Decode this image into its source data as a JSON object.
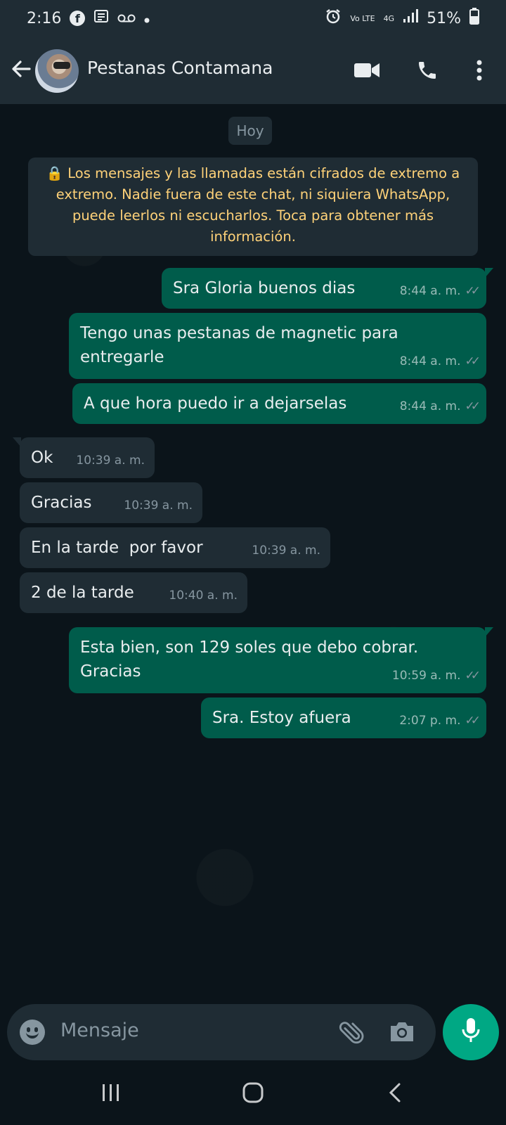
{
  "status_bar": {
    "time": "2:16",
    "battery": "51%",
    "network": "4G",
    "volte": "Vo LTE"
  },
  "header": {
    "contact_name": "Pestanas Contamana",
    "icons": [
      "back-arrow-icon",
      "avatar",
      "video-call-icon",
      "voice-call-icon",
      "more-options-icon"
    ]
  },
  "chat": {
    "day_label": "Hoy",
    "encryption_notice": "🔒 Los mensajes y las llamadas están cifrados de extremo a extremo. Nadie fuera de este chat, ni siquiera WhatsApp, puede leerlos ni escucharlos. Toca para obtener más información.",
    "messages": [
      {
        "direction": "out",
        "text": "Sra Gloria buenos dias",
        "time": "8:44 a. m."
      },
      {
        "direction": "out",
        "text": "Tengo unas pestanas de magnetic para entregarle",
        "time": "8:44 a. m."
      },
      {
        "direction": "out",
        "text": "A que hora puedo ir a dejarselas",
        "time": "8:44 a. m."
      },
      {
        "direction": "in",
        "text": "Ok",
        "time": "10:39 a. m."
      },
      {
        "direction": "in",
        "text": "Gracias",
        "time": "10:39 a. m."
      },
      {
        "direction": "in",
        "text": "En la tarde  por favor",
        "time": "10:39 a. m."
      },
      {
        "direction": "in",
        "text": "2 de la tarde",
        "time": "10:40 a. m."
      },
      {
        "direction": "out",
        "text": "Esta bien, son 129 soles que debo cobrar. Gracias",
        "time": "10:59 a. m."
      },
      {
        "direction": "out",
        "text": "Sra. Estoy afuera",
        "time": "2:07 p. m."
      }
    ]
  },
  "composer": {
    "placeholder": "Mensaje"
  },
  "colors": {
    "outgoing_bubble": "#005c4b",
    "incoming_bubble": "#1f2c34",
    "accent": "#00a884",
    "background": "#0b141a",
    "notice_text": "#ffd279"
  }
}
